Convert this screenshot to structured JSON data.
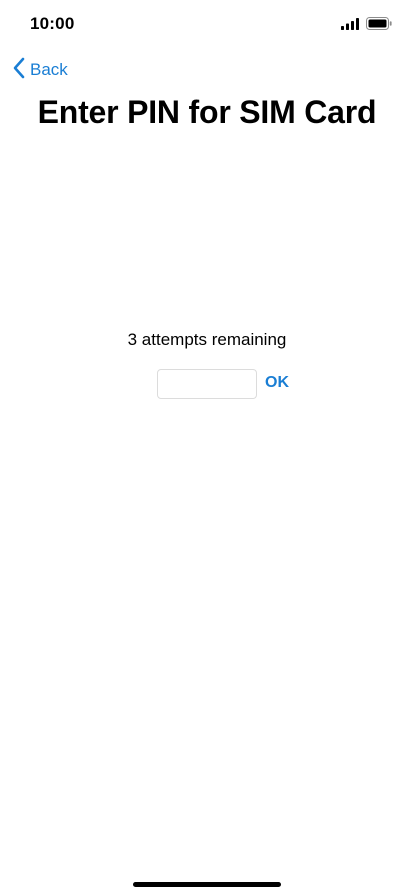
{
  "status_bar": {
    "time": "10:00",
    "signal_icon": "cellular-signal-icon",
    "battery_icon": "battery-icon"
  },
  "nav": {
    "back_label": "Back",
    "back_icon": "chevron-left-icon"
  },
  "page": {
    "title": "Enter PIN for SIM Card",
    "attempts_text": "3 attempts remaining"
  },
  "pin_form": {
    "input_value": "",
    "input_placeholder": "",
    "ok_label": "OK"
  },
  "colors": {
    "accent": "#1a7ed4",
    "text": "#000000",
    "background": "#ffffff",
    "input_border": "#dcdcdc"
  }
}
